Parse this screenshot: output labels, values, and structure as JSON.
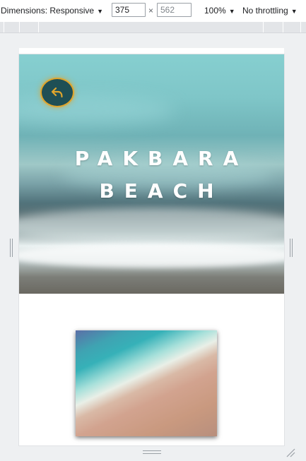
{
  "devtools": {
    "dimensions_label": "Dimensions: Responsive",
    "width_value": "375",
    "height_value": "562",
    "times": "×",
    "zoom": "100%",
    "throttling": "No throttling",
    "caret": "▼"
  },
  "page": {
    "back_button_icon": "back-arrow-icon",
    "title_line1": "PAKBARA",
    "title_line2": "BEACH",
    "accent_color": "#e0a52c",
    "button_color": "#1f4f55"
  }
}
